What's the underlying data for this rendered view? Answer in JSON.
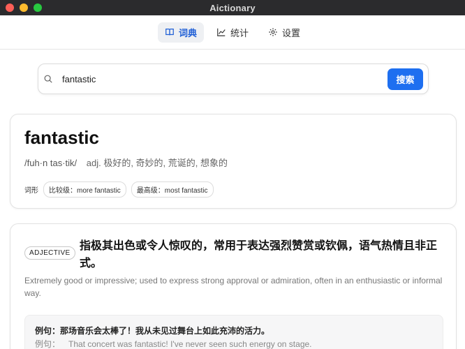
{
  "window": {
    "title": "Aictionary"
  },
  "tabs": [
    {
      "label": "词典",
      "icon": "book-icon",
      "active": true
    },
    {
      "label": "统计",
      "icon": "chart-icon",
      "active": false
    },
    {
      "label": "设置",
      "icon": "gear-icon",
      "active": false
    }
  ],
  "search": {
    "value": "fantastic",
    "button_label": "搜索"
  },
  "entry": {
    "word": "fantastic",
    "phonetic": "/fuh·n tas·tik/",
    "pos_translation": "adj. 极好的, 奇妙的, 荒诞的, 想象的",
    "forms_label": "词形",
    "forms": [
      {
        "text": "比较级：more fantastic"
      },
      {
        "text": "最高级：most fantastic"
      }
    ]
  },
  "sense": {
    "pos_badge": "ADJECTIVE",
    "zh": "指极其出色或令人惊叹的，常用于表达强烈赞赏或钦佩，语气热情且非正式。",
    "en": "Extremely good or impressive; used to express strong approval or admiration, often in an enthusiastic or informal way.",
    "example": {
      "zh": "例句：那场音乐会太棒了！我从未见过舞台上如此充沛的活力。",
      "en_label": "例句：",
      "en": "That concert was fantastic! I've never seen such energy on stage."
    }
  },
  "colors": {
    "accent": "#1e6ff0",
    "titlebar": "#2b2b2d"
  }
}
